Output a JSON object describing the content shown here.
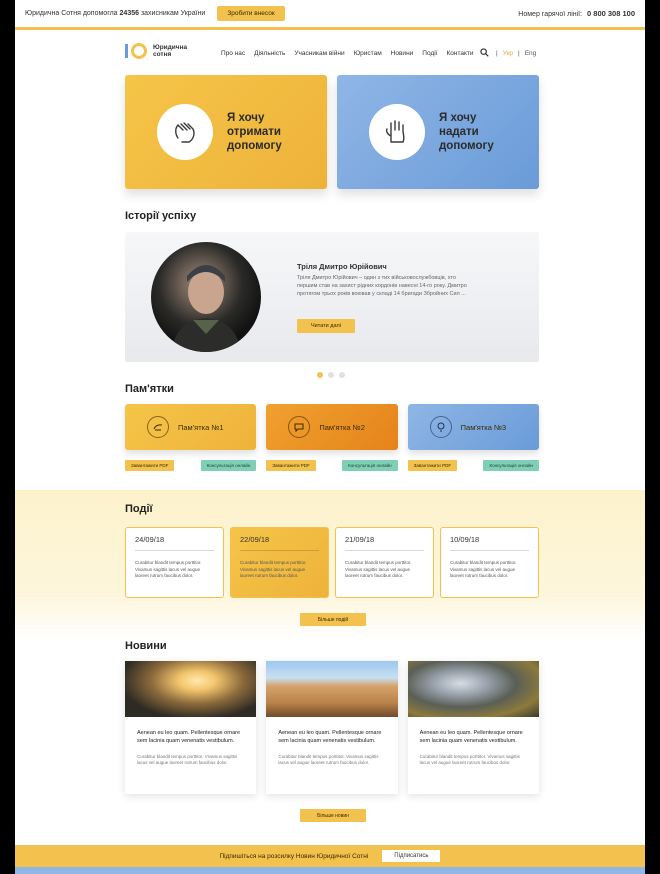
{
  "topbar": {
    "notice_prefix": "Юридична Сотня допомогла",
    "notice_count": "24356",
    "notice_suffix": "захисникам України",
    "help_button": "Зробити внесок",
    "hotline_label": "Номер гарячої лінії:",
    "hotline_number": "0 800 308 100"
  },
  "header": {
    "logo_text": "Юридична сотня",
    "nav": [
      "Про нас",
      "Діяльність",
      "Учасникам війни",
      "Юристам",
      "Новини",
      "Події",
      "Контакти"
    ],
    "languages": [
      "Укр",
      "Eng"
    ],
    "active_language": "Укр"
  },
  "help_cards": [
    {
      "label": "Я хочу отримати допомогу",
      "icon": "hand-receive-icon"
    },
    {
      "label": "Я хочу надати допомогу",
      "icon": "hand-give-icon"
    }
  ],
  "stories": {
    "title": "Історії успіху",
    "name": "Тріля Дмитро Юрійович",
    "text": "Тріля Дмитро Юрійович – один з тих військовослужбовців, хто першим став на захист рідних кордонів навесні 14-го року. Дмитро протягом трьох років воював у складі 14 бригади Збройних Сил ...",
    "read_more": "Читати далі",
    "slides": 3,
    "active_slide": 1
  },
  "memos": {
    "title": "Пам'ятки",
    "items": [
      {
        "label": "Пам'ятка №1",
        "pdf": "Завантажити PDF",
        "consult": "Консультація онлайн"
      },
      {
        "label": "Пам'ятка №2",
        "pdf": "Завантажити PDF",
        "consult": "Консультація онлайн"
      },
      {
        "label": "Пам'ятка №3",
        "pdf": "Завантажити PDF",
        "consult": "Консультація онлайн"
      }
    ]
  },
  "events": {
    "title": "Події",
    "items": [
      {
        "date": "24/09/18",
        "desc": "Curabitur blandit tempus porttitor. Vivamus sagittis lacus vel augue laoreet rutrum faucibus dolor."
      },
      {
        "date": "22/09/18",
        "desc": "Curabitur blandit tempus porttitor. Vivamus sagittis lacus vel augue laoreet rutrum faucibus dolor."
      },
      {
        "date": "21/09/18",
        "desc": "Curabitur blandit tempus porttitor. Vivamus sagittis lacus vel augue laoreet rutrum faucibus dolor."
      },
      {
        "date": "10/09/18",
        "desc": "Curabitur blandit tempus porttitor. Vivamus sagittis lacus vel augue laoreet rutrum faucibus dolor."
      }
    ],
    "more": "Більше подій"
  },
  "news": {
    "title": "Новини",
    "items": [
      {
        "title": "Aenean eu leo quam. Pellentesque ornare sem lacinia quam venenatis vestibulum.",
        "desc": "Curabitur blandit tempus porttitor. Vivamus sagittis lacus vel augue laoreet rutrum faucibus dolor."
      },
      {
        "title": "Aenean eu leo quam. Pellentesque ornare sem lacinia quam venenatis vestibulum.",
        "desc": "Curabitur blandit tempus porttitor. Vivamus sagittis lacus vel augue laoreet rutrum faucibus dolor."
      },
      {
        "title": "Aenean eu leo quam. Pellentesque ornare sem lacinia quam venenatis vestibulum.",
        "desc": "Curabitur blandit tempus porttitor. Vivamus sagittis lacus vel augue laoreet rutrum faucibus dolor."
      }
    ],
    "more": "Більше новин"
  },
  "subscribe": {
    "text": "Підпишіться на розсилку Новин Юридичної Сотні",
    "button": "Підписатись"
  },
  "colors": {
    "yellow": "#f2c14e",
    "orange": "#e5831a",
    "blue": "#6a9bd8",
    "mint": "#7fcfb6"
  }
}
